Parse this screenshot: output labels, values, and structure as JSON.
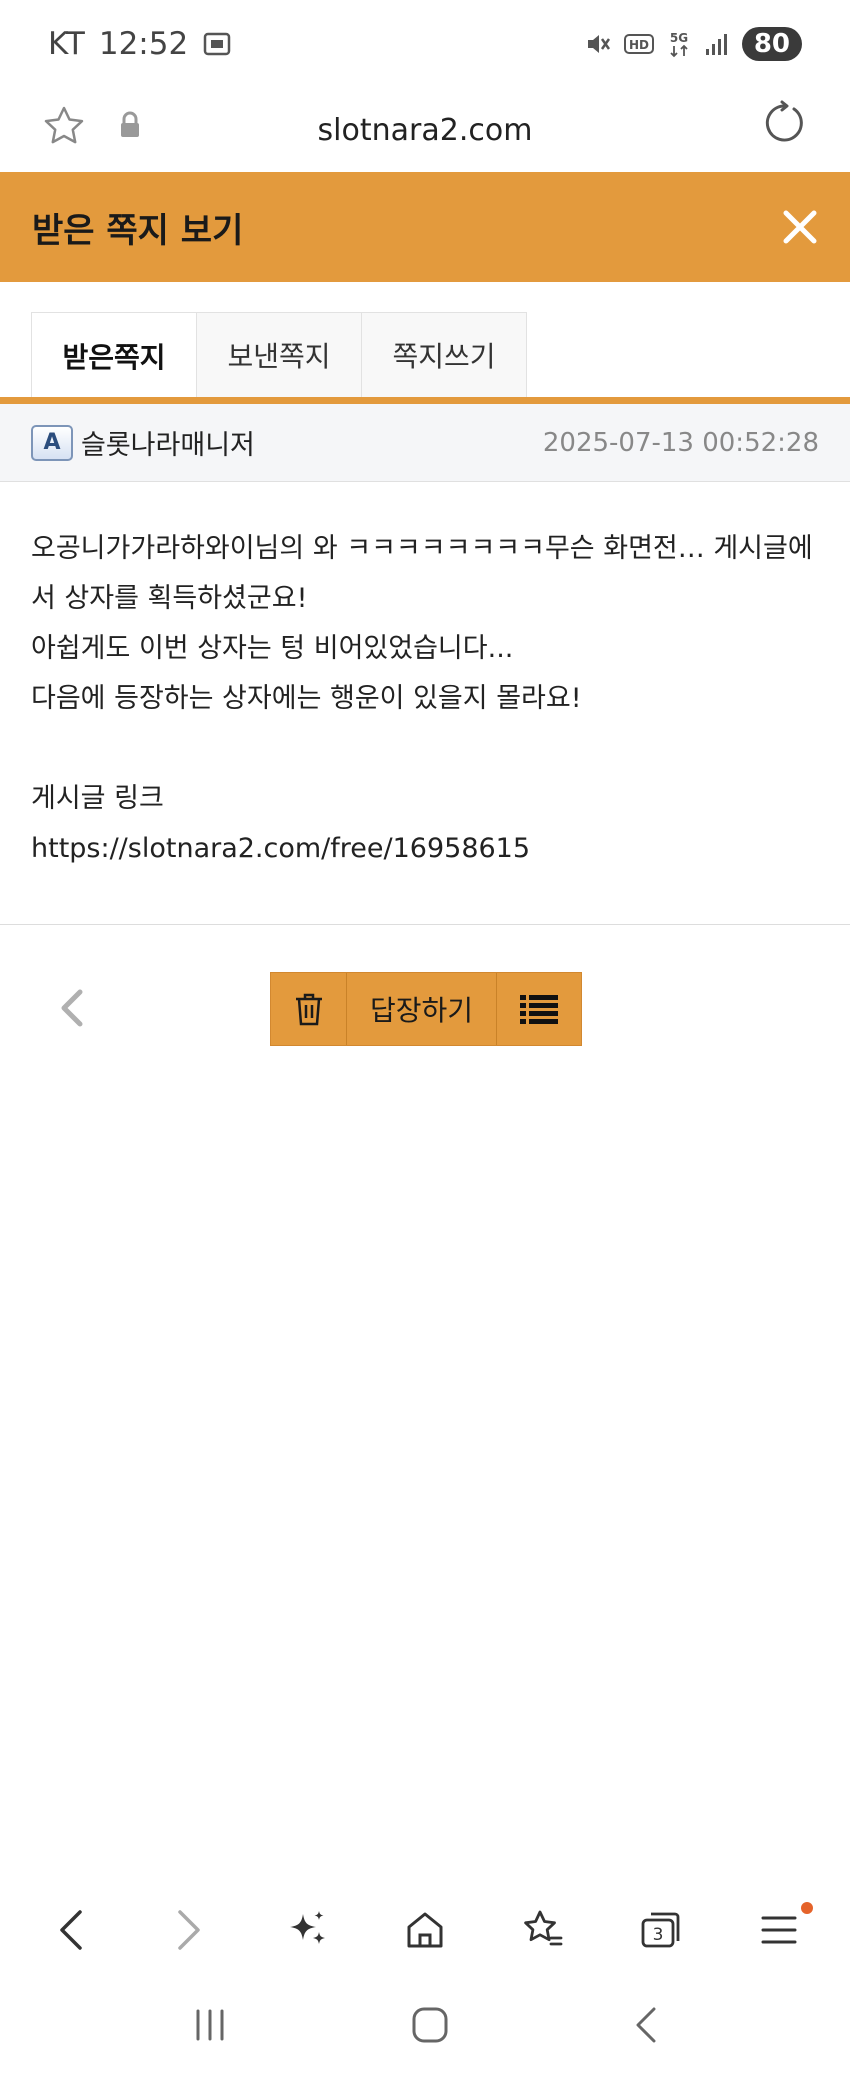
{
  "status_bar": {
    "carrier": "KT",
    "time": "12:52",
    "battery": "80",
    "icons": [
      "screenshot-icon",
      "mute-icon",
      "hd-icon",
      "5g-icon",
      "signal-icon"
    ]
  },
  "browser": {
    "url": "slotnara2.com"
  },
  "header": {
    "title": "받은 쪽지 보기"
  },
  "tabs": [
    {
      "label": "받은쪽지",
      "active": true
    },
    {
      "label": "보낸쪽지",
      "active": false
    },
    {
      "label": "쪽지쓰기",
      "active": false
    }
  ],
  "message": {
    "sender_badge": "A",
    "sender": "슬롯나라매니저",
    "date": "2025-07-13 00:52:28",
    "lines": [
      "오공니가가라하와이님의 와 ㅋㅋㅋㅋㅋㅋㅋㅋ무슨 화면전… 게시글에",
      "서 상자를 획득하셨군요!",
      "아쉽게도 이번 상자는 텅 비어있었습니다...",
      "다음에 등장하는 상자에는 행운이 있을지 몰라요!"
    ],
    "link_label": "게시글 링크",
    "link": "https://slotnara2.com/free/16958615"
  },
  "actions": {
    "reply_label": "답장하기"
  },
  "colors": {
    "accent": "#e39a3d",
    "info_bg": "#f5f6f8"
  }
}
